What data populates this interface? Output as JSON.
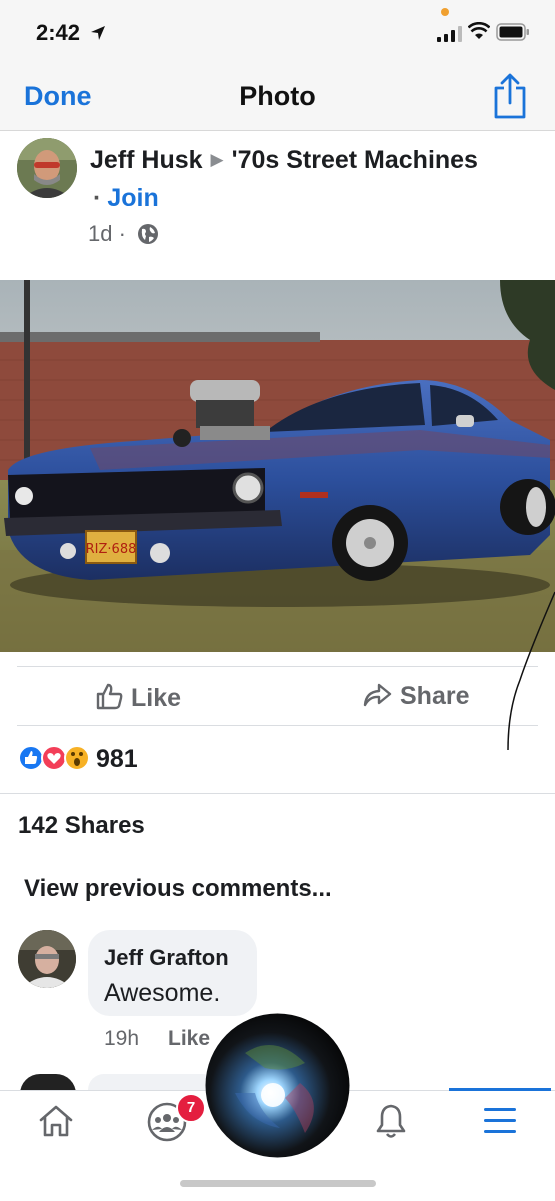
{
  "status_bar": {
    "time": "2:42"
  },
  "nav": {
    "done_label": "Done",
    "title": "Photo"
  },
  "post": {
    "author": "Jeff Husk",
    "group": "'70s Street Machines",
    "join_label": "Join",
    "join_separator": "·",
    "age": "1d ·"
  },
  "actions": {
    "like_label": "Like",
    "share_label": "Share"
  },
  "reactions": {
    "count": "981"
  },
  "shares_text": "142 Shares",
  "view_previous": "View previous comments...",
  "comment": {
    "author": "Jeff Grafton",
    "text": "Awesome.",
    "time": "19h",
    "like_label": "Like"
  },
  "tabbar": {
    "notification_badge": "7"
  },
  "colors": {
    "accent": "#1a73d9",
    "badge": "#e41e3f"
  }
}
